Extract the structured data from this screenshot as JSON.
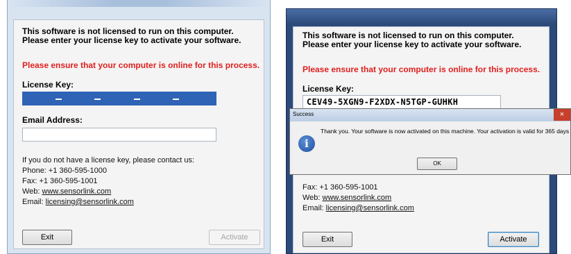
{
  "screen_left": {
    "header_line1": "This software is not licensed to run on this computer.",
    "header_line2": "Please enter your license key to activate your software.",
    "warning": "Please ensure that your computer is online for this process.",
    "license_label": "License Key:",
    "email_label": "Email Address:",
    "email_value": "",
    "contact_intro": "If you do not have a license key, please contact us:",
    "phone": "Phone: +1 360-595-1000",
    "fax": "Fax: +1 360-595-1001",
    "web_prefix": "Web: ",
    "web_link": "www.sensorlink.com",
    "email_prefix": "Email: ",
    "email_link": "licensing@sensorlink.com",
    "exit_button": "Exit",
    "activate_button": "Activate",
    "activate_enabled": false
  },
  "screen_right": {
    "header_line1": "This software is not licensed to run on this computer.",
    "header_line2": "Please enter your license key to activate your software.",
    "warning": "Please ensure that your computer is online for this process.",
    "license_label": "License Key:",
    "license_value": "CEV49-5XGN9-F2XDX-N5TGP-GUHKH",
    "fax": "Fax: +1 360-595-1001",
    "web_prefix": "Web: ",
    "web_link": "www.sensorlink.com",
    "email_prefix": "Email: ",
    "email_link": "licensing@sensorlink.com",
    "exit_button": "Exit",
    "activate_button": "Activate",
    "activate_enabled": true
  },
  "dialog": {
    "title": "Success",
    "message": "Thank you. Your software is now activated on this machine. Your activation is valid for 365 days",
    "ok_button": "OK",
    "close_glyph": "×",
    "icon": "info-icon",
    "icon_glyph": "i"
  },
  "colors": {
    "warning": "#e01f1f",
    "selection": "#2f63b6",
    "close_button": "#c7402b"
  }
}
